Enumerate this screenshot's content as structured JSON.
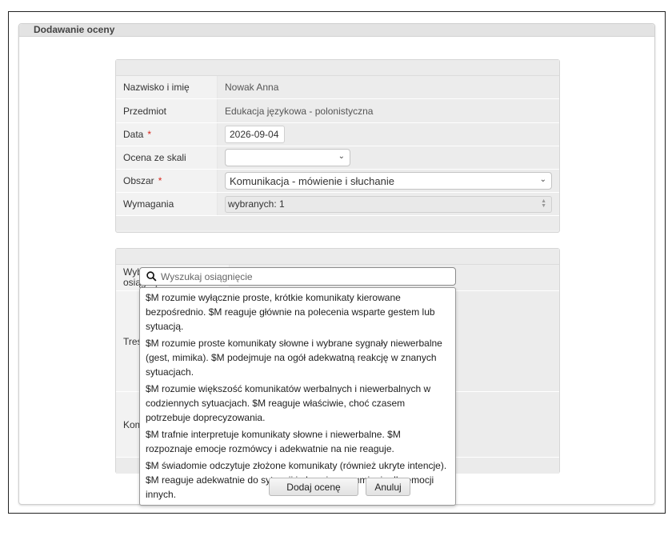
{
  "panel": {
    "title": "Dodawanie oceny"
  },
  "form": {
    "name_label": "Nazwisko i imię",
    "name_value": "Nowak Anna",
    "subject_label": "Przedmiot",
    "subject_value": "Edukacja językowa - polonistyczna",
    "date_label": "Data",
    "date_value": "2026-09-04",
    "scale_label": "Ocena ze skali",
    "scale_value": "",
    "area_label": "Obszar",
    "area_value": "Komunikacja - mówienie i słuchanie",
    "requirements_label": "Wymagania",
    "requirements_value": "wybranych: 1",
    "required_mark": "*"
  },
  "achievement": {
    "choose_label": "Wybierz propozycję osiągnięcia",
    "content_label": "Treść oceny",
    "comment_label": "Komentarz",
    "search_placeholder": "Wyszukaj osiągnięcie",
    "options": [
      "$M rozumie wyłącznie proste, krótkie komunikaty kierowane bezpośrednio. $M reaguje głównie na polecenia wsparte gestem lub sytuacją.",
      "$M rozumie proste komunikaty słowne i wybrane sygnały niewerbalne (gest, mimika). $M podejmuje na ogół adekwatną reakcję w znanych sytuacjach.",
      "$M rozumie większość komunikatów werbalnych i niewerbalnych w codziennych sytuacjach. $M reaguje właściwie, choć czasem potrzebuje doprecyzowania.",
      "$M trafnie interpretuje komunikaty słowne i niewerbalne. $M rozpoznaje emocje rozmówcy i adekwatnie na nie reaguje.",
      "$M świadomie odczytuje złożone komunikaty (również ukryte intencje). $M reaguje adekwatnie do sytuacji i okazuje zrozumienie dla emocji innych."
    ]
  },
  "actions": {
    "submit_label": "Dodaj ocenę",
    "cancel_label": "Anuluj"
  }
}
